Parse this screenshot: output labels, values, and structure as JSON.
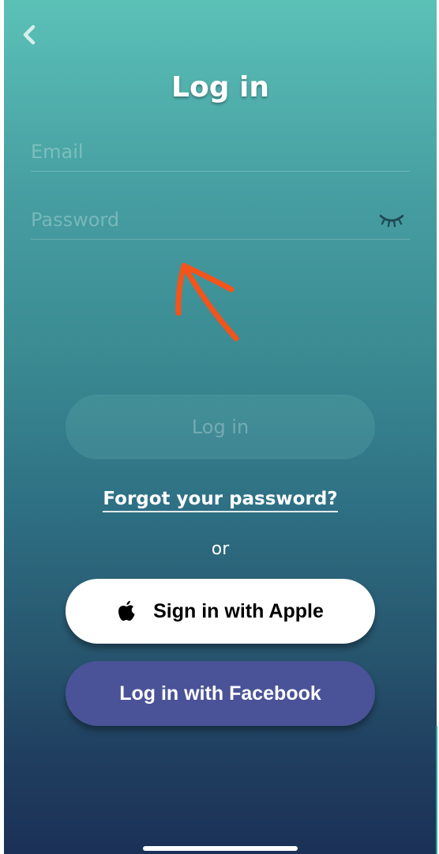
{
  "header": {
    "title": "Log in"
  },
  "form": {
    "email_placeholder": "Email",
    "password_placeholder": "Password",
    "login_label": "Log in"
  },
  "links": {
    "forgot_password": "Forgot your password?"
  },
  "divider": {
    "or": "or"
  },
  "social": {
    "apple_label": "Sign in with Apple",
    "facebook_label": "Log in with Facebook"
  },
  "icons": {
    "back": "chevron-left-icon",
    "password_toggle": "eye-closed-icon",
    "apple": "apple-icon",
    "annotation": "arrow-up-left-icon"
  },
  "colors": {
    "gradient_top": "#5bc1b7",
    "gradient_bottom": "#1b3157",
    "facebook_button": "#4a5397",
    "apple_button": "#ffffff",
    "annotation_arrow": "#f2541b"
  }
}
